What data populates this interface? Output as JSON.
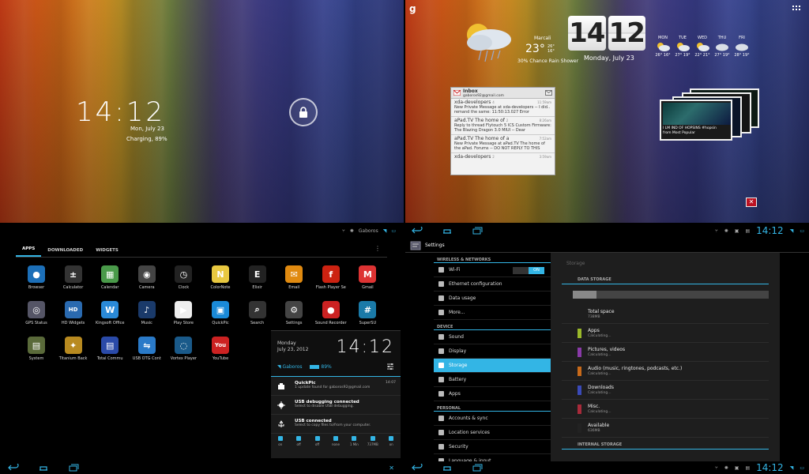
{
  "lockscreen": {
    "time": "14:12",
    "date": "Mon, July 23",
    "charging": "Charging, 89%"
  },
  "home": {
    "google": "g",
    "weather": {
      "location": "Marcali",
      "temp": "23°",
      "hi": "26°",
      "lo": "16°",
      "condition": "30% Chance Rain Shower"
    },
    "clock": {
      "hour": "14",
      "minute": "12",
      "date": "Monday, July 23"
    },
    "forecast": [
      {
        "day": "MON",
        "temp": "26° 16°"
      },
      {
        "day": "TUE",
        "temp": "27° 19°"
      },
      {
        "day": "WED",
        "temp": "22° 21°"
      },
      {
        "day": "THU",
        "temp": "27° 19°"
      },
      {
        "day": "FRI",
        "temp": "28° 19°"
      }
    ],
    "gmail": {
      "title": "Inbox",
      "account": "gaboros92@gmail.com",
      "messages": [
        {
          "from": "xda-developers",
          "count": "4",
          "time": "11:59am",
          "preview": "New Private Message at xda-developers -- I did.. remand the same: 11:50:13.027 Error"
        },
        {
          "from": "aPad.TV The home of",
          "count": "2",
          "time": "8:26am",
          "preview": "Reply to thread Flytouch 5 ICS Custom Firmware: The Blazing Dragon 3.0 MIUI -- Dear"
        },
        {
          "from": "aPad.TV The home of a",
          "count": "",
          "time": "7:52am",
          "preview": "New Private Message at aPad.TV The home of the aPad. Forums -- DO NOT REPLY TO THIS"
        },
        {
          "from": "xda-developers",
          "count": "2",
          "time": "3:59am",
          "preview": ""
        }
      ]
    },
    "youtube": {
      "caption": "I LM IND OF HOPSINS #hopsin",
      "source": "from Most Popular"
    }
  },
  "drawer": {
    "status": {
      "user": "Gaboros",
      "battery": "89%"
    },
    "tabs": [
      "APPS",
      "DOWNLOADED",
      "WIDGETS"
    ],
    "apps": [
      {
        "name": "Browser",
        "glyph": "●",
        "color": "#1c6fb8"
      },
      {
        "name": "Calculator",
        "glyph": "±",
        "color": "#333"
      },
      {
        "name": "Calendar",
        "glyph": "▦",
        "color": "#4a9a4a"
      },
      {
        "name": "Camera",
        "glyph": "◉",
        "color": "#444"
      },
      {
        "name": "Clock",
        "glyph": "◷",
        "color": "#222"
      },
      {
        "name": "ColorNote",
        "glyph": "N",
        "color": "#e8c840"
      },
      {
        "name": "Elixir",
        "glyph": "E",
        "color": "#222"
      },
      {
        "name": "Email",
        "glyph": "✉",
        "color": "#e08a10"
      },
      {
        "name": "Flash Player Se",
        "glyph": "f",
        "color": "#c21"
      },
      {
        "name": "Gmail",
        "glyph": "M",
        "color": "#d33"
      },
      {
        "name": "GPS Status",
        "glyph": "◎",
        "color": "#556"
      },
      {
        "name": "HD Widgets",
        "glyph": "HD",
        "color": "#2a6ab0"
      },
      {
        "name": "Kingsoft Office",
        "glyph": "W",
        "color": "#2a8ad8"
      },
      {
        "name": "Music",
        "glyph": "♪",
        "color": "#1a3a6a"
      },
      {
        "name": "Play Store",
        "glyph": "▶",
        "color": "#eee"
      },
      {
        "name": "QuickPic",
        "glyph": "▣",
        "color": "#1a8ad8"
      },
      {
        "name": "Search",
        "glyph": "⌕",
        "color": "#333"
      },
      {
        "name": "Settings",
        "glyph": "⚙",
        "color": "#444"
      },
      {
        "name": "Sound Recorder",
        "glyph": "●",
        "color": "#c22"
      },
      {
        "name": "SuperSU",
        "glyph": "#",
        "color": "#1a7aa8"
      },
      {
        "name": "System",
        "glyph": "▤",
        "color": "#5a6a3a"
      },
      {
        "name": "Titanium Back",
        "glyph": "✦",
        "color": "#b88a20"
      },
      {
        "name": "Total Commu",
        "glyph": "▤",
        "color": "#2a4aa8"
      },
      {
        "name": "USB OTG Cont",
        "glyph": "⇋",
        "color": "#2a7ac8"
      },
      {
        "name": "Vortex Player",
        "glyph": "◌",
        "color": "#1a5a8a"
      },
      {
        "name": "YouTube",
        "glyph": "You",
        "color": "#c22"
      }
    ],
    "notif": {
      "day": "Monday",
      "date": "July 23, 2012",
      "time": "14:12",
      "wifi": "Gaboros",
      "battery": "89%",
      "items": [
        {
          "title": "QuickPic",
          "text": "1 update found for gaboros92@gmail.com",
          "time": "14:07"
        },
        {
          "title": "USB debugging connected",
          "text": "Select to disable USB debugging.",
          "time": ""
        },
        {
          "title": "USB connected",
          "text": "Select to copy files to/from your computer.",
          "time": ""
        }
      ],
      "toggles": [
        "on",
        "off",
        "off",
        "none",
        "1 Min",
        "737MB",
        "on"
      ]
    }
  },
  "settings": {
    "clock": "14:12",
    "title": "Settings",
    "left": [
      {
        "type": "cat",
        "label": "WIRELESS & NETWORKS"
      },
      {
        "type": "row",
        "label": "Wi-Fi",
        "toggle": "ON"
      },
      {
        "type": "row",
        "label": "Ethernet configuration"
      },
      {
        "type": "row",
        "label": "Data usage"
      },
      {
        "type": "row",
        "label": "More..."
      },
      {
        "type": "cat",
        "label": "DEVICE"
      },
      {
        "type": "row",
        "label": "Sound"
      },
      {
        "type": "row",
        "label": "Display"
      },
      {
        "type": "row",
        "label": "Storage",
        "selected": true
      },
      {
        "type": "row",
        "label": "Battery"
      },
      {
        "type": "row",
        "label": "Apps"
      },
      {
        "type": "cat",
        "label": "PERSONAL"
      },
      {
        "type": "row",
        "label": "Accounts & sync"
      },
      {
        "type": "row",
        "label": "Location services"
      },
      {
        "type": "row",
        "label": "Security"
      },
      {
        "type": "row",
        "label": "Language & input"
      }
    ],
    "right": {
      "header": "Storage",
      "data_storage": "DATA STORAGE",
      "internal_storage": "INTERNAL STORAGE",
      "items": [
        {
          "title": "Total space",
          "sub": "738MB",
          "color": ""
        },
        {
          "title": "Apps",
          "sub": "Calculating...",
          "color": "#9ab82a"
        },
        {
          "title": "Pictures, videos",
          "sub": "Calculating...",
          "color": "#8a3aa8"
        },
        {
          "title": "Audio (music, ringtones, podcasts, etc.)",
          "sub": "Calculating...",
          "color": "#c86a1a"
        },
        {
          "title": "Downloads",
          "sub": "Calculating...",
          "color": "#3a4ab8"
        },
        {
          "title": "Misc.",
          "sub": "Calculating...",
          "color": "#a82a3a"
        },
        {
          "title": "Available",
          "sub": "636MB",
          "color": "#222"
        }
      ]
    }
  }
}
